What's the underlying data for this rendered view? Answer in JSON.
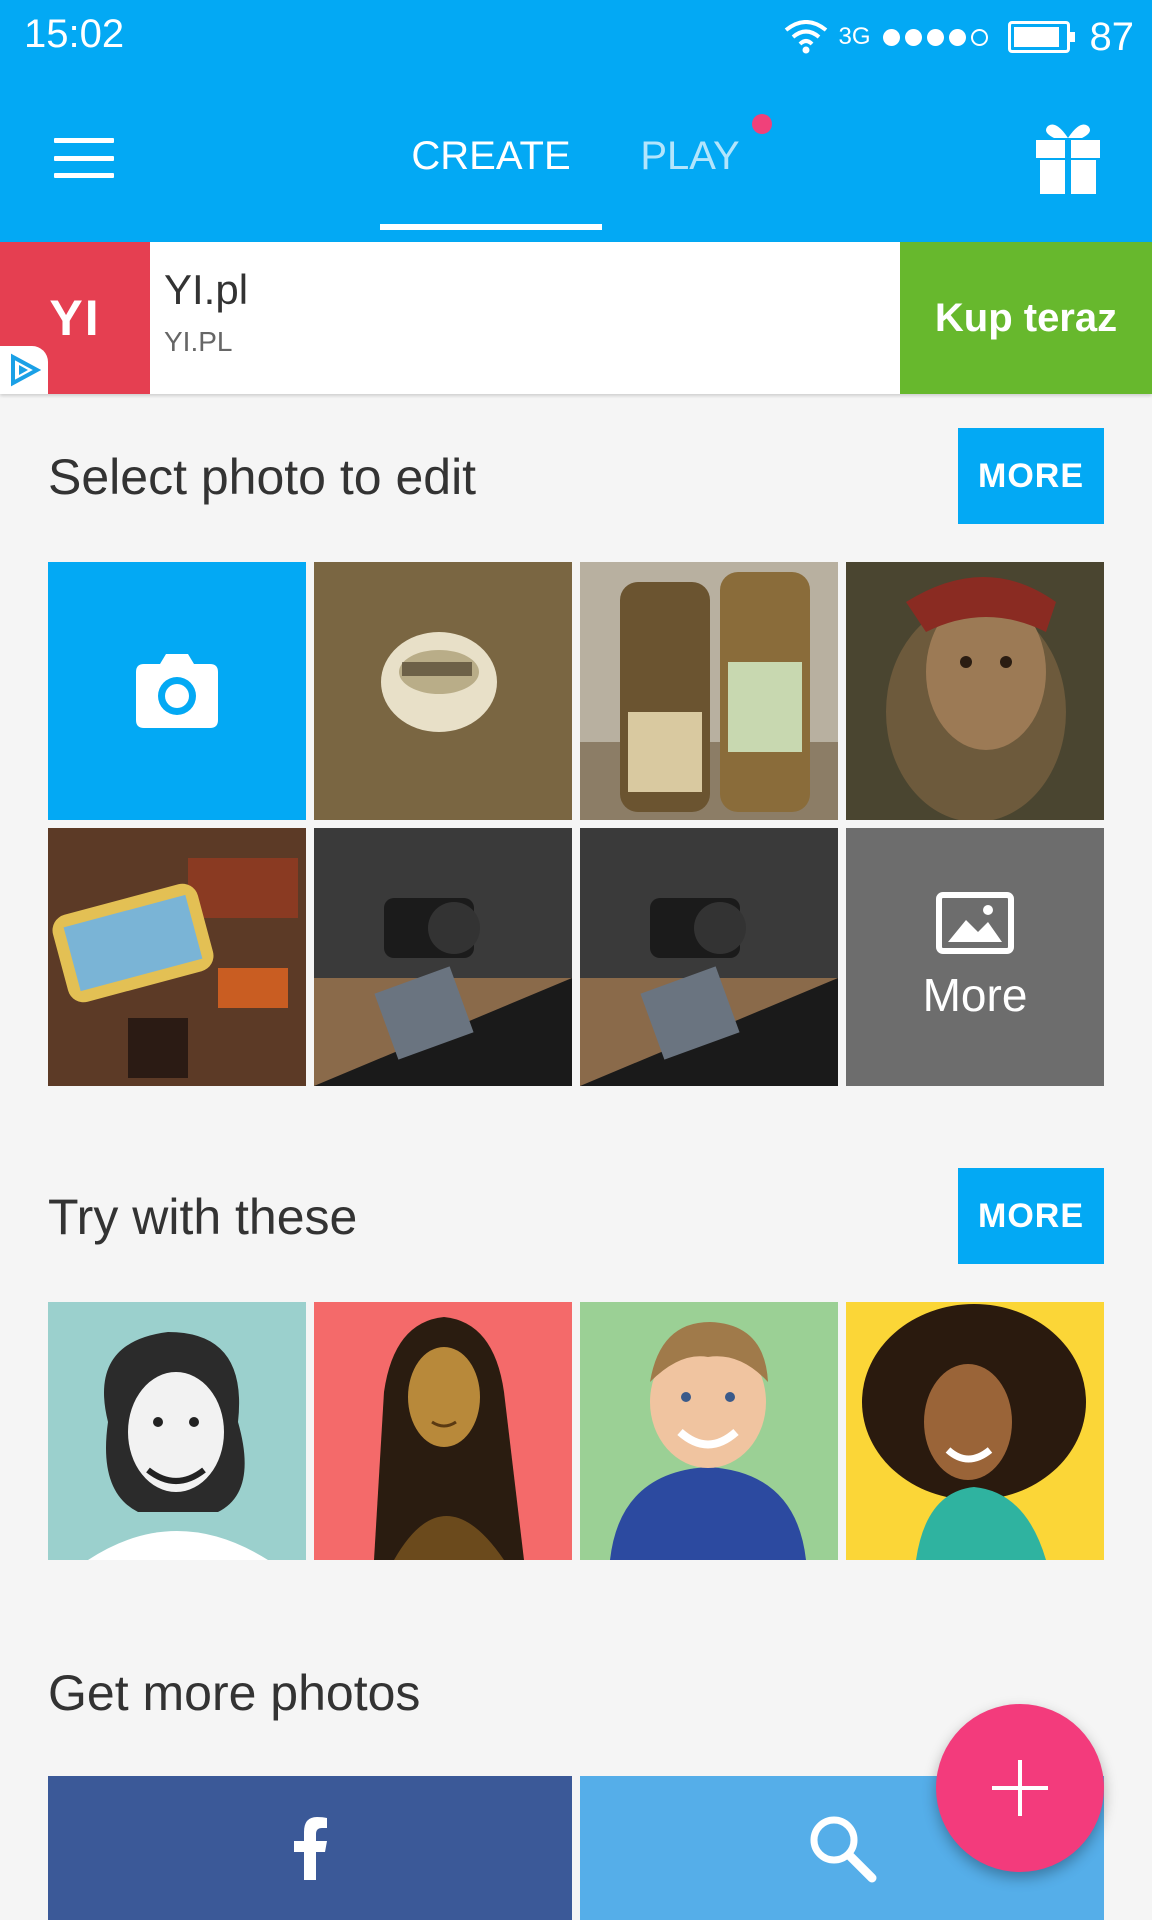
{
  "status_bar": {
    "time": "15:02",
    "network": "3G",
    "battery": "87"
  },
  "tabs": [
    {
      "label": "CREATE",
      "active": true
    },
    {
      "label": "PLAY",
      "active": false
    }
  ],
  "ad": {
    "logo": "YI",
    "title": "YI.pl",
    "subtitle": "YI.PL",
    "cta": "Kup teraz"
  },
  "select_section": {
    "title": "Select photo to edit",
    "more_label": "MORE",
    "more_tile_label": "More",
    "photos": [
      "camera",
      "photo-bottle-cap",
      "photo-beer-bottles",
      "photo-selfie",
      "photo-toys",
      "photo-camera-desk-1",
      "photo-camera-desk-2",
      "more"
    ]
  },
  "try_section": {
    "title": "Try with these",
    "more_label": "MORE",
    "samples": [
      {
        "bg": "#9bd0cd"
      },
      {
        "bg": "#f46a6a"
      },
      {
        "bg": "#9bd095"
      },
      {
        "bg": "#fbd637"
      }
    ]
  },
  "get_more_section": {
    "title": "Get more photos"
  },
  "colors": {
    "primary": "#03a9f4",
    "fab": "#f33b7c",
    "facebook": "#3b5998",
    "search": "#55aee9"
  },
  "icons": [
    "menu-icon",
    "gift-icon",
    "camera-icon",
    "image-icon",
    "facebook-icon",
    "search-icon",
    "plus-icon"
  ]
}
